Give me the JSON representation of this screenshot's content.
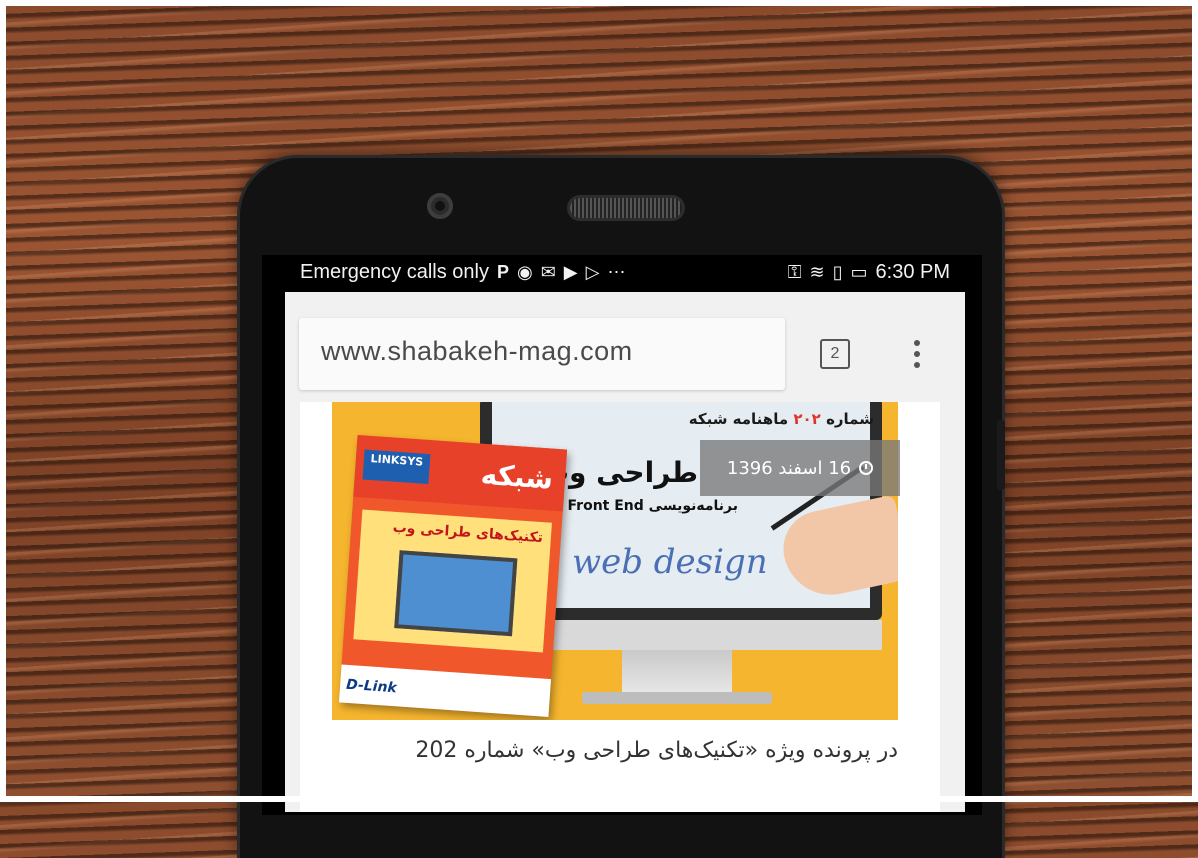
{
  "status_bar": {
    "carrier_text": "Emergency calls only",
    "notification_icons": [
      "pinterest-icon",
      "telegram-icon",
      "mail-icon",
      "play-store-icon",
      "play-icon",
      "more-icon"
    ],
    "system_icons": [
      "key-icon",
      "wifi-icon",
      "sim-icon",
      "battery-icon"
    ],
    "time": "6:30 PM"
  },
  "browser": {
    "url": "www.shabakeh-mag.com",
    "tab_count": "2"
  },
  "article": {
    "hero": {
      "issue_line_prefix": "شماره",
      "issue_number": "۲۰۲",
      "issue_line_suffix": "ماهنامه شبکه",
      "headline": "طراحی وب",
      "subline": "برنامه‌نویسی Front End",
      "script_text": "web design",
      "magazine": {
        "brand": "LINKSYS",
        "title": "شبکه",
        "feature": "تکنیک‌های طراحی وب",
        "sponsor": "D-Link"
      }
    },
    "date_badge": "16 اسفند 1396",
    "caption": "در پرونده ویژه «تکنیک‌های طراحی وب» شماره 202"
  }
}
